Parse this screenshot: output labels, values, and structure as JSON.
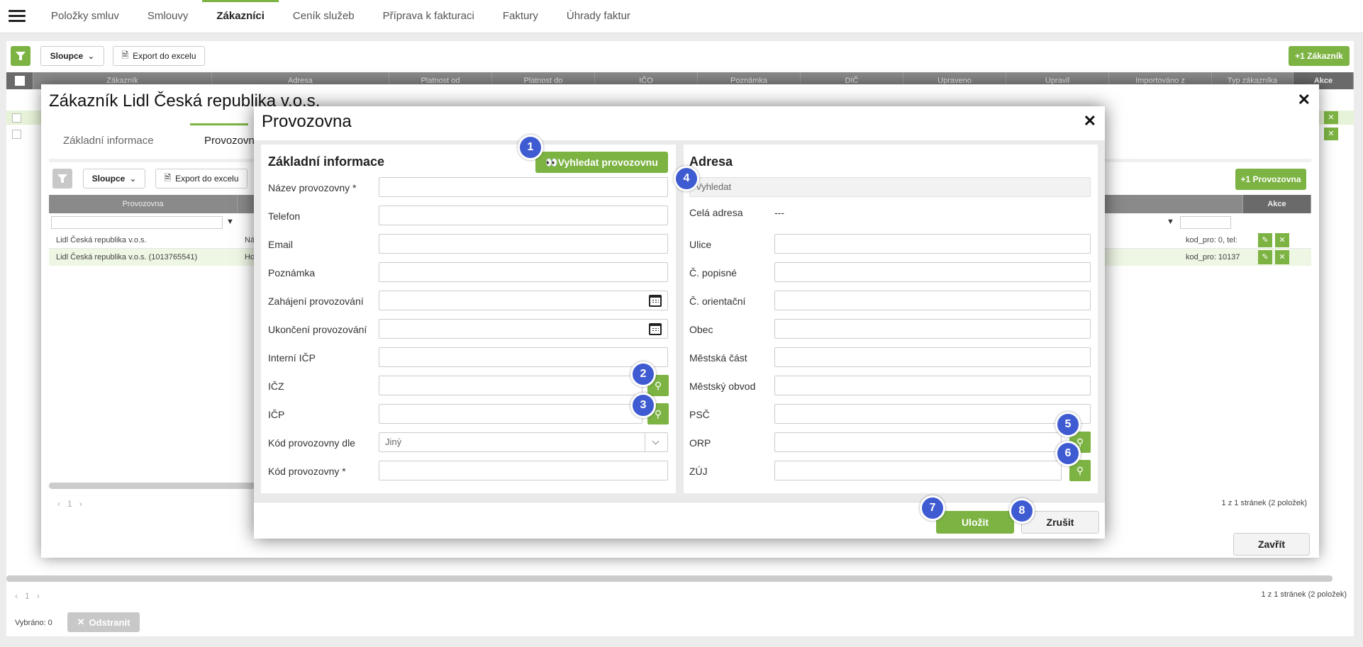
{
  "nav": {
    "tabs": [
      "Položky smluv",
      "Smlouvy",
      "Zákazníci",
      "Ceník služeb",
      "Příprava k fakturaci",
      "Faktury",
      "Úhrady faktur"
    ]
  },
  "toolbar": {
    "columns_label": "Sloupce",
    "export_label": "Export do excelu",
    "add_customer_label": "+1 Zákazník"
  },
  "grid": {
    "columns": [
      "Zákazník",
      "Adresa",
      "Platnost od",
      "Platnost do",
      "IČO",
      "Poznámka",
      "DIČ",
      "Upraveno",
      "Upravil",
      "Importováno z",
      "Typ zákazníka",
      "Akce"
    ]
  },
  "footer": {
    "pagination": "1",
    "pages_info": "1 z 1 stránek (2 položek)",
    "selected_label": "Vybráno: 0",
    "remove_label": "Odstranit"
  },
  "customer_modal": {
    "title": "Zákazník Lidl Česká republika v.o.s.",
    "tabs": [
      "Základní informace",
      "Provozovny"
    ],
    "columns_label": "Sloupce",
    "export_label": "Export do excelu",
    "add_label": "+1 Provozovna",
    "grid_columns": [
      "Provozovna",
      "Akce"
    ],
    "rows": [
      {
        "name": "Lidl Česká republika v.o.s.",
        "mid": "Ná",
        "code": "kod_pro: 0, tel:"
      },
      {
        "name": "Lidl Česká republika v.o.s. (1013765541)",
        "mid": "Ho",
        "code": "kod_pro: 10137"
      }
    ],
    "pagination": "1",
    "pages_info": "1 z 1 stránek (2 položek)",
    "close_label": "Zavřít"
  },
  "prov_modal": {
    "title": "Provozovna",
    "left": {
      "heading": "Základní informace",
      "search_button": "Vyhledat provozovnu",
      "fields": [
        "Název provozovny *",
        "Telefon",
        "Email",
        "Poznámka",
        "Zahájení provozování",
        "Ukončení provozování",
        "Interní IČP",
        "IČZ",
        "IČP",
        "Kód provozovny dle",
        "Kód provozovny *"
      ],
      "select_value": "Jiný"
    },
    "right": {
      "heading": "Adresa",
      "search_placeholder": "Vyhledat",
      "full_address_label": "Celá adresa",
      "full_address_value": "---",
      "fields": [
        "Ulice",
        "Č. popisné",
        "Č. orientační",
        "Obec",
        "Městská část",
        "Městský obvod",
        "PSČ",
        "ORP",
        "ZÚJ"
      ]
    },
    "save_label": "Uložit",
    "cancel_label": "Zrušit"
  },
  "badges": [
    "1",
    "2",
    "3",
    "4",
    "5",
    "6",
    "7",
    "8"
  ],
  "colors": {
    "accent": "#7cb342",
    "badge": "#3f5bd1"
  }
}
